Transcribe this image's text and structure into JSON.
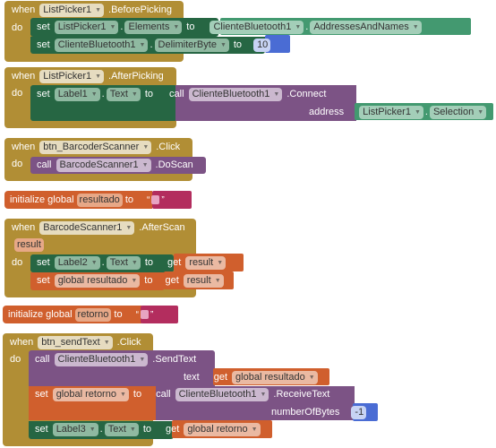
{
  "kw": {
    "when": "when",
    "do": "do",
    "set": "set",
    "to": "to",
    "call": "call",
    "get": "get",
    "dot": ".",
    "init": "initialize global"
  },
  "blocks": {
    "b1": {
      "component": "ListPicker1",
      "event": ".BeforePicking",
      "s1": {
        "comp": "ListPicker1",
        "prop": "Elements",
        "val_comp": "ClienteBluetooth1",
        "val_prop": "AddressesAndNames"
      },
      "s2": {
        "comp": "ClienteBluetooth1",
        "prop": "DelimiterByte",
        "val": "10"
      }
    },
    "b2": {
      "component": "ListPicker1",
      "event": ".AfterPicking",
      "s1": {
        "comp": "Label1",
        "prop": "Text",
        "call_comp": "ClienteBluetooth1",
        "method": ".Connect",
        "arg": "address",
        "arg_comp": "ListPicker1",
        "arg_prop": "Selection"
      }
    },
    "b3": {
      "component": "btn_BarcoderScanner",
      "event": ".Click",
      "call_comp": "BarcodeScanner1",
      "method": ".DoScan"
    },
    "g1": {
      "name": "resultado",
      "q": "“",
      "q2": "”"
    },
    "b4": {
      "component": "BarcodeScanner1",
      "event": ".AfterScan",
      "param": "result",
      "s1": {
        "comp": "Label2",
        "prop": "Text",
        "get": "result"
      },
      "s2": {
        "var": "global resultado",
        "get": "result"
      }
    },
    "g2": {
      "name": "retorno",
      "q": "“",
      "q2": "”"
    },
    "b5": {
      "component": "btn_sendText",
      "event": ".Click",
      "c1": {
        "comp": "ClienteBluetooth1",
        "method": ".SendText",
        "arg": "text",
        "get": "global resultado"
      },
      "s1": {
        "var": "global retorno",
        "call_comp": "ClienteBluetooth1",
        "method": ".ReceiveText",
        "arg": "numberOfBytes",
        "val": "-1"
      },
      "s2": {
        "comp": "Label3",
        "prop": "Text",
        "get": "global retorno"
      }
    }
  }
}
